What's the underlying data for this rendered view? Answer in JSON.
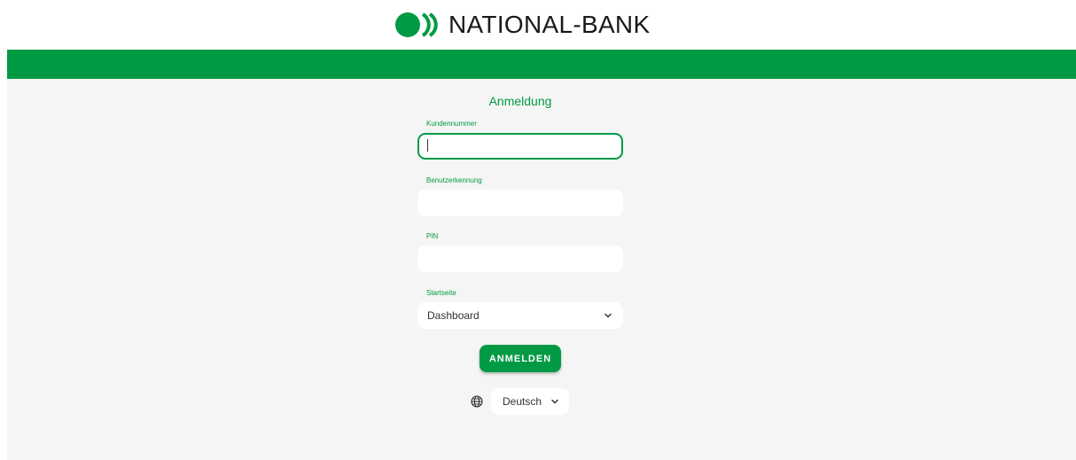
{
  "header": {
    "brand_name": "NATIONAL-BANK",
    "logo_icon": "national-bank-logo-icon",
    "brand_color": "#009a44"
  },
  "login": {
    "title": "Anmeldung",
    "customer_number_label": "Kundennummer",
    "customer_number_value": "",
    "user_id_label": "Benutzerkennung",
    "user_id_value": "",
    "pin_label": "PIN",
    "pin_value": "",
    "start_page_label": "Startseite",
    "start_page_selected": "Dashboard",
    "submit_label": "ANMELDEN"
  },
  "language": {
    "icon": "globe-icon",
    "selected": "Deutsch"
  }
}
